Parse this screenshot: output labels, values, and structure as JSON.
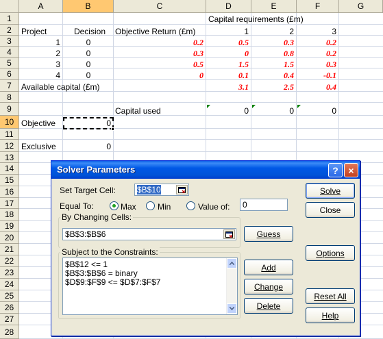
{
  "sheet": {
    "columns": [
      "A",
      "B",
      "C",
      "D",
      "E",
      "F",
      "G"
    ],
    "rows": [
      "1",
      "2",
      "3",
      "4",
      "5",
      "6",
      "7",
      "8",
      "9",
      "10",
      "11",
      "12",
      "13",
      "14",
      "15",
      "16",
      "17",
      "18",
      "19",
      "20",
      "21",
      "22",
      "23",
      "24",
      "25",
      "26",
      "27",
      "28"
    ],
    "selected_column": "B",
    "selected_row": "10",
    "cells": {
      "c1_capreq": "Capital requirements (£m)",
      "a2": "Project",
      "b2": "Decision",
      "c2": "Objective Return (£m)",
      "d2": "1",
      "e2": "2",
      "f2": "3",
      "a3": "1",
      "b3": "0",
      "c3": "0.2",
      "d3": "0.5",
      "e3": "0.3",
      "f3": "0.2",
      "a4": "2",
      "b4": "0",
      "c4": "0.3",
      "d4": "0",
      "e4": "0.8",
      "f4": "0.2",
      "a5": "3",
      "b5": "0",
      "c5": "0.5",
      "d5": "1.5",
      "e5": "1.5",
      "f5": "0.3",
      "a6": "4",
      "b6": "0",
      "c6": "0",
      "d6": "0.1",
      "e6": "0.4",
      "f6": "-0.1",
      "a7": "Available capital (£m)",
      "d7": "3.1",
      "e7": "2.5",
      "f7": "0.4",
      "c9": "Capital used",
      "d9": "0",
      "e9": "0",
      "f9": "0",
      "a10": "Objective",
      "b10": "0",
      "a12": "Exclusive",
      "b12": "0"
    }
  },
  "dialog": {
    "title": "Solver Parameters",
    "help_symbol": "?",
    "close_symbol": "×",
    "target_cell_label": "Set Target Cell:",
    "target_cell_value": "$B$10",
    "equal_to_label": "Equal To:",
    "radio_max": "Max",
    "radio_min": "Min",
    "radio_value_of": "Value of:",
    "value_of_field": "0",
    "selected_option": "Max",
    "changing_cells_label": "By Changing Cells:",
    "changing_cells_value": "$B$3:$B$6",
    "constraints_label": "Subject to the Constraints:",
    "constraints": [
      "$B$12 <= 1",
      "$B$3:$B$6 = binary",
      "$D$9:$F$9 <= $D$7:$F$7"
    ],
    "buttons": {
      "solve": "Solve",
      "close": "Close",
      "guess": "Guess",
      "options": "Options",
      "add": "Add",
      "change": "Change",
      "delete": "Delete",
      "reset_all": "Reset All",
      "help": "Help"
    }
  },
  "colors": {
    "negative_emphasis": "#ff0000",
    "title_bar": "#0054e3",
    "dialog_bg": "#ece9d8",
    "selected_header": "#ffc871"
  }
}
